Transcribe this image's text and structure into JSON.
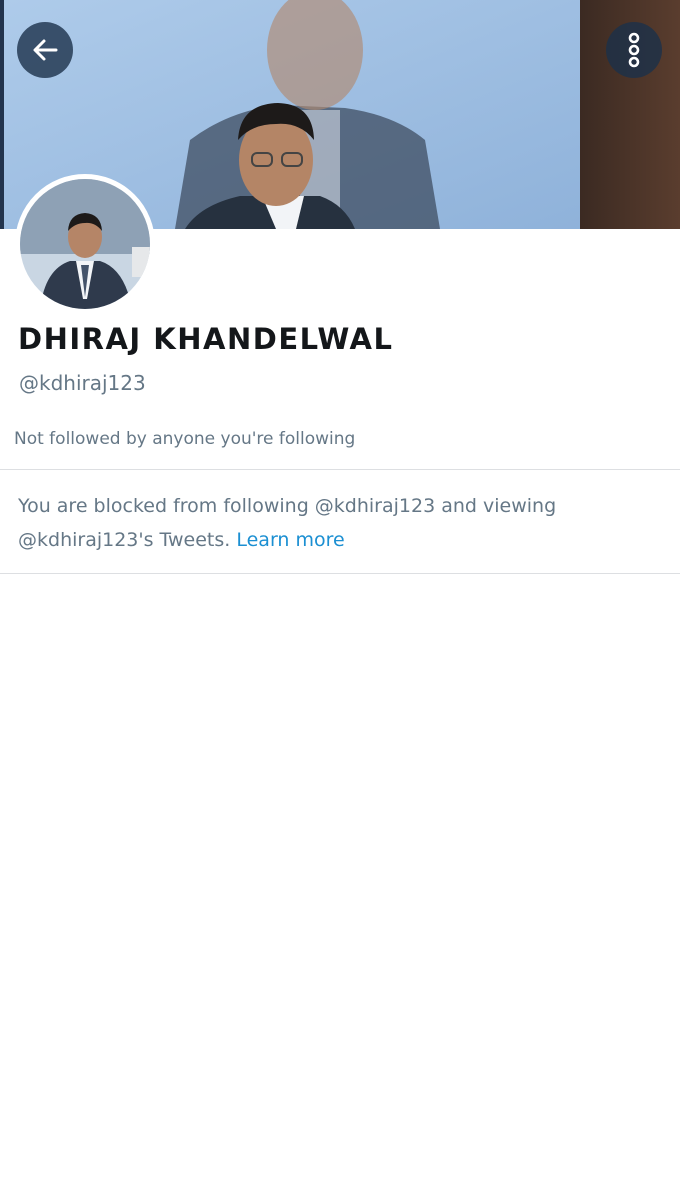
{
  "profile": {
    "display_name": "DHIRAJ KHANDELWAL",
    "handle": "@kdhiraj123",
    "followers_context": "Not followed by anyone you're following"
  },
  "blocked": {
    "message": "You are blocked from following @kdhiraj123 and viewing @kdhiraj123's Tweets.",
    "link_label": "Learn more"
  },
  "icons": {
    "back": "arrow-left-icon",
    "more": "more-vertical-icon"
  },
  "colors": {
    "link": "#1b8fd2",
    "secondary_text": "#657786",
    "primary_text": "#14171a",
    "overlay_button": "#1b314a"
  }
}
